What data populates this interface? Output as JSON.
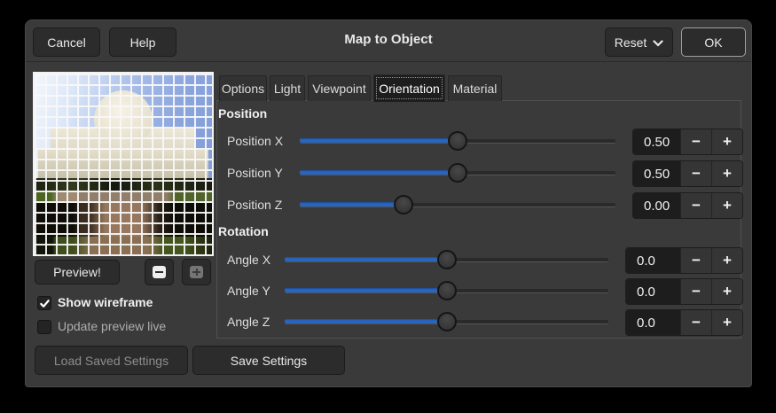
{
  "dialog": {
    "title": "Map to Object",
    "header": {
      "cancel": "Cancel",
      "help": "Help",
      "reset": "Reset",
      "ok": "OK"
    },
    "tabs": [
      {
        "label": "Options",
        "active": false
      },
      {
        "label": "Light",
        "active": false
      },
      {
        "label": "Viewpoint",
        "active": false
      },
      {
        "label": "Orientation",
        "active": true
      },
      {
        "label": "Material",
        "active": false
      }
    ],
    "panel": {
      "sections": [
        {
          "heading": "Position",
          "rows": [
            {
              "label": "Position X",
              "value": "0.50",
              "frac": 0.5
            },
            {
              "label": "Position Y",
              "value": "0.50",
              "frac": 0.5
            },
            {
              "label": "Position Z",
              "value": "0.00",
              "frac": 0.33
            }
          ]
        },
        {
          "heading": "Rotation",
          "rows": [
            {
              "label": "Angle X",
              "value": "0.0",
              "frac": 0.5
            },
            {
              "label": "Angle Y",
              "value": "0.0",
              "frac": 0.5
            },
            {
              "label": "Angle Z",
              "value": "0.0",
              "frac": 0.5
            }
          ]
        }
      ],
      "spin_minus": "−",
      "spin_plus": "+"
    },
    "preview_panel": {
      "preview_button": "Preview!",
      "show_wireframe": "Show wireframe",
      "update_live": "Update preview live",
      "show_wireframe_checked": true,
      "update_live_checked": false
    },
    "footer": {
      "load": "Load Saved Settings",
      "save": "Save Settings"
    },
    "colors": {
      "accent_blue": "#2c68c4",
      "dialog_bg": "#3a3a3a",
      "field_bg": "#1d1d1d"
    }
  }
}
